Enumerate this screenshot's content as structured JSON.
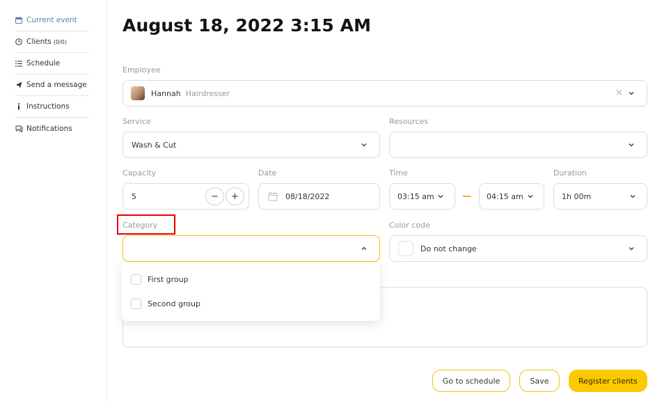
{
  "sidebar": {
    "items": [
      {
        "label": "Current event",
        "sub": "",
        "icon": "calendar-icon"
      },
      {
        "label": "Clients",
        "sub": "(0/0)",
        "icon": "clock-icon"
      },
      {
        "label": "Schedule",
        "sub": "",
        "icon": "list-icon"
      },
      {
        "label": "Send a message",
        "sub": "",
        "icon": "send-icon"
      },
      {
        "label": "Instructions",
        "sub": "",
        "icon": "info-icon"
      },
      {
        "label": "Notifications",
        "sub": "",
        "icon": "chat-icon"
      }
    ]
  },
  "title": "August 18, 2022 3:15 AM",
  "employee": {
    "label": "Employee",
    "name": "Hannah",
    "role": "Hairdresser"
  },
  "service": {
    "label": "Service",
    "value": "Wash & Cut"
  },
  "resources": {
    "label": "Resources",
    "value": ""
  },
  "capacity": {
    "label": "Capacity",
    "value": "5",
    "minus": "−",
    "plus": "+"
  },
  "date": {
    "label": "Date",
    "value": "08/18/2022"
  },
  "time": {
    "label": "Time",
    "start": "03:15 am",
    "end": "04:15 am"
  },
  "duration": {
    "label": "Duration",
    "value": "1h 00m"
  },
  "category": {
    "label": "Category",
    "value": "",
    "options": [
      "First group",
      "Second group"
    ]
  },
  "color_code": {
    "label": "Color code",
    "value": "Do not change"
  },
  "buttons": {
    "go_to_schedule": "Go to schedule",
    "save": "Save",
    "register": "Register clients"
  },
  "colors": {
    "accent": "#fcc800",
    "active_link": "#5b7fb5",
    "highlight": "#e00000"
  }
}
